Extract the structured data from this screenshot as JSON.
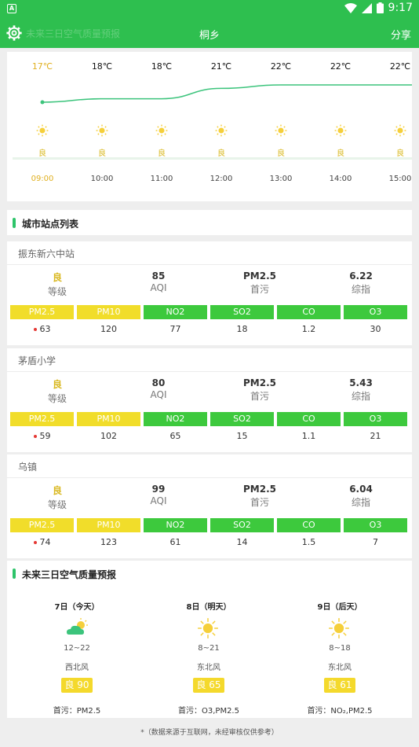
{
  "status_bar": {
    "time": "9:17",
    "app_badge": "A"
  },
  "app_bar": {
    "title": "桐乡",
    "ghost_text": "未来三日空气质量预报",
    "share_label": "分享"
  },
  "hourly": {
    "items": [
      {
        "temp": "17℃",
        "quality": "良",
        "time": "09:00",
        "current": true,
        "temp_value": 17
      },
      {
        "temp": "18℃",
        "quality": "良",
        "time": "10:00",
        "current": false,
        "temp_value": 18
      },
      {
        "temp": "18℃",
        "quality": "良",
        "time": "11:00",
        "current": false,
        "temp_value": 18
      },
      {
        "temp": "21℃",
        "quality": "良",
        "time": "12:00",
        "current": false,
        "temp_value": 21
      },
      {
        "temp": "22℃",
        "quality": "良",
        "time": "13:00",
        "current": false,
        "temp_value": 22
      },
      {
        "temp": "22℃",
        "quality": "良",
        "time": "14:00",
        "current": false,
        "temp_value": 22
      },
      {
        "temp": "22℃",
        "quality": "良",
        "time": "15:00",
        "current": false,
        "temp_value": 22
      }
    ]
  },
  "stations_section": {
    "title": "城市站点列表"
  },
  "metric_labels": {
    "grade": "等级",
    "aqi": "AQI",
    "primary": "首污",
    "index": "综指"
  },
  "pollutant_names": [
    "PM2.5",
    "PM10",
    "NO2",
    "SO2",
    "CO",
    "O3"
  ],
  "stations": [
    {
      "name": "振东新六中站",
      "grade": "良",
      "aqi": "85",
      "primary": "PM2.5",
      "index": "6.22",
      "values": [
        "63",
        "120",
        "77",
        "18",
        "1.2",
        "30"
      ]
    },
    {
      "name": "茅盾小学",
      "grade": "良",
      "aqi": "80",
      "primary": "PM2.5",
      "index": "5.43",
      "values": [
        "59",
        "102",
        "65",
        "15",
        "1.1",
        "21"
      ]
    },
    {
      "name": "乌镇",
      "grade": "良",
      "aqi": "99",
      "primary": "PM2.5",
      "index": "6.04",
      "values": [
        "74",
        "123",
        "61",
        "14",
        "1.5",
        "7"
      ]
    }
  ],
  "forecast_section": {
    "title": "未来三日空气质量预报"
  },
  "forecast": [
    {
      "day": "7日（今天）",
      "icon": "partly-cloudy-icon",
      "range": "12~22",
      "wind": "西北风",
      "badge": "良 90",
      "primary": "首污：PM2.5"
    },
    {
      "day": "8日（明天）",
      "icon": "sun-icon",
      "range": "8~21",
      "wind": "东北风",
      "badge": "良 65",
      "primary": "首污：O3,PM2.5"
    },
    {
      "day": "9日（后天）",
      "icon": "sun-icon",
      "range": "8~18",
      "wind": "东北风",
      "badge": "良 61",
      "primary": "首污：NO₂,PM2.5"
    }
  ],
  "footer": "*（数据来源于互联网，未经审核仅供参考）",
  "colors": {
    "brand": "#2ebf4f",
    "good": "#d9b820",
    "pill_yellow": "#f1dd2a",
    "pill_green": "#3dc93d"
  }
}
